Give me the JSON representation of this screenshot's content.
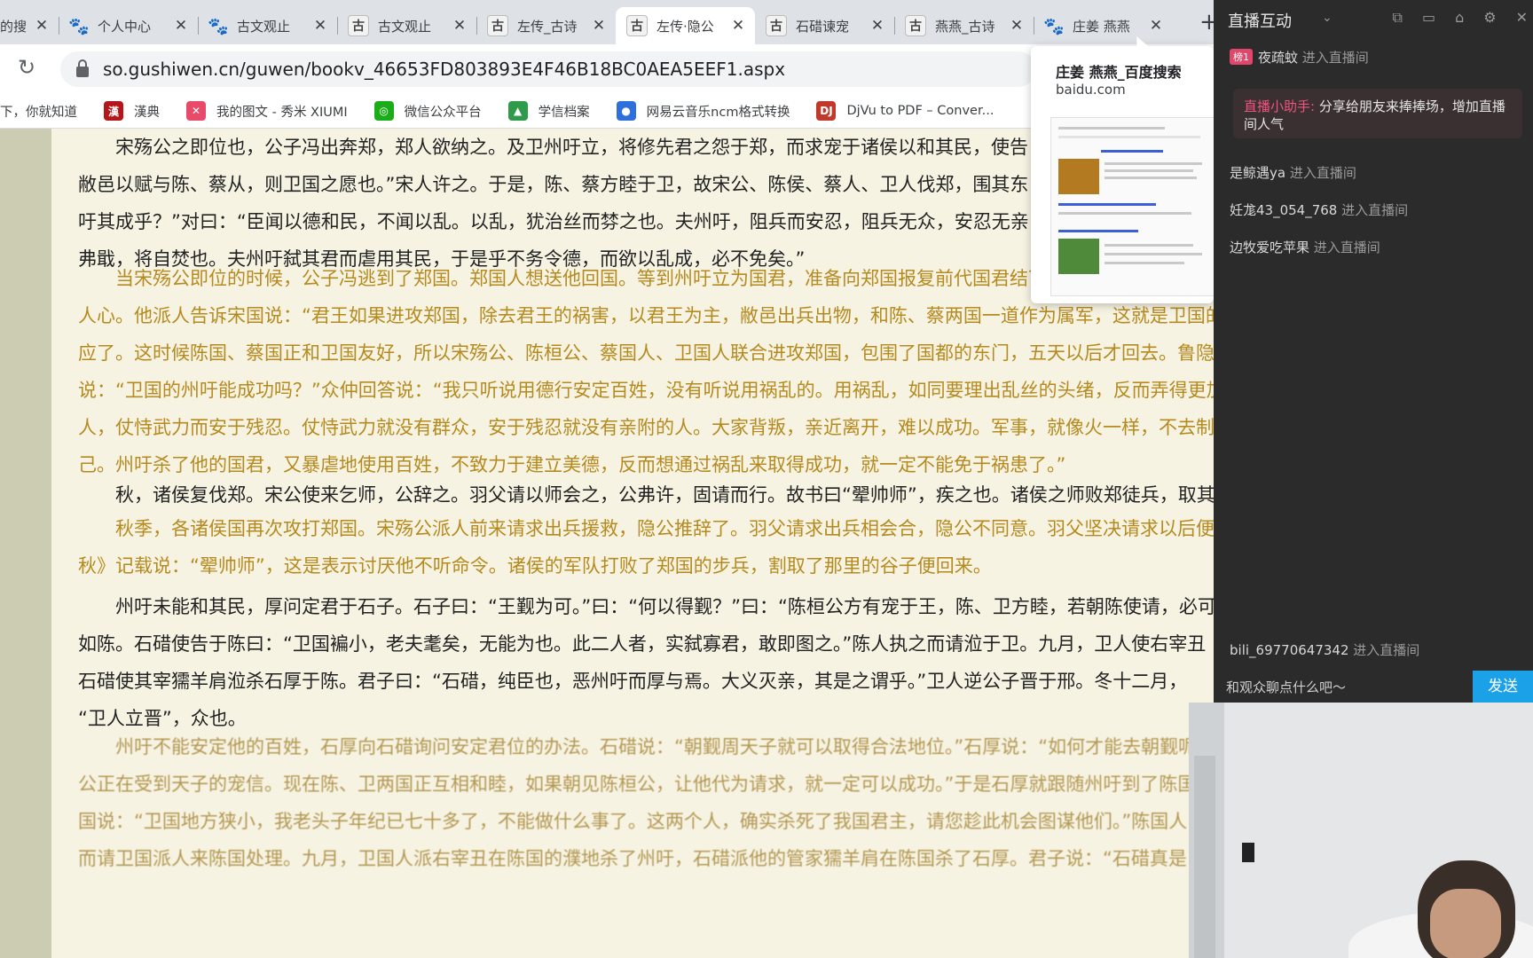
{
  "browser": {
    "tabs": [
      {
        "icon": "paw",
        "title": "的搜",
        "active": false
      },
      {
        "icon": "paw",
        "title": "个人中心",
        "active": false
      },
      {
        "icon": "paw",
        "title": "古文观止",
        "active": false
      },
      {
        "icon": "gu",
        "title": "古文观止",
        "active": false
      },
      {
        "icon": "gu",
        "title": "左传_古诗",
        "active": false
      },
      {
        "icon": "gu",
        "title": "左传·隐公",
        "active": true
      },
      {
        "icon": "gu",
        "title": "石碏谏宠",
        "active": false
      },
      {
        "icon": "gu",
        "title": "燕燕_古诗",
        "active": false
      },
      {
        "icon": "paw",
        "title": "庄姜 燕燕",
        "active": false
      }
    ],
    "new_tab": "+",
    "url": "so.gushiwen.cn/guwen/bookv_46653FD803893E4F46B18BC0AEA5EEF1.aspx",
    "bookmarks": [
      {
        "label": "下，你就知道",
        "icon": "",
        "color": ""
      },
      {
        "label": "漢典",
        "icon": "漢",
        "color": "#b5161b"
      },
      {
        "label": "我的图文 - 秀米 XIUMI",
        "icon": "✕",
        "color": "#e84b6a"
      },
      {
        "label": "微信公众平台",
        "icon": "◎",
        "color": "#1aad19"
      },
      {
        "label": "学信档案",
        "icon": "▲",
        "color": "#2e9b4a"
      },
      {
        "label": "网易云音乐ncm格式转换",
        "icon": "●",
        "color": "#2f6fdb"
      },
      {
        "label": "DjVu to PDF – Conver...",
        "icon": "DJ",
        "color": "#c0392b"
      }
    ]
  },
  "popup": {
    "title": "庄姜 燕燕_百度搜索",
    "domain": "baidu.com"
  },
  "article": {
    "paragraphs": [
      {
        "type": "orig",
        "lines": [
          "宋殇公之即位也，公子冯出奔郑，郑人欲纳之。及卫州吁立，将修先君之怨于郑，而求宠于诸侯以和其民，使告",
          "敝邑以赋与陈、蔡从，则卫国之愿也。”宋人许之。于是，陈、蔡方睦于卫，故宋公、陈侯、蔡人、卫人伐郑，围其东",
          "吁其成乎？”对曰：“臣闻以德和民，不闻以乱。以乱，犹治丝而棼之也。夫州吁，阻兵而安忍，阻兵无众，安忍无亲，",
          "弗戢，将自焚也。夫州吁弑其君而虐用其民，于是乎不务令德，而欲以乱成，必不免矣。”"
        ]
      },
      {
        "type": "trans",
        "lines": [
          "当宋殇公即位的时候，公子冯逃到了郑国。郑国人想送他回国。等到州吁立为国君，准备向郑国报复前代国君结下的怨恨，以此讨好诸侯",
          "人心。他派人告诉宋国说：“君王如果进攻郑国，除去君王的祸害，以君王为主，敝邑出兵出物，和陈、蔡两国一道作为属军，这就是卫国的",
          "应了。这时候陈国、蔡国正和卫国友好，所以宋殇公、陈桓公、蔡国人、卫国人联合进攻郑国，包围了国都的东门，五天以后才回去。鲁隐",
          "说：“卫国的州吁能成功吗？”众仲回答说：“我只听说用德行安定百姓，没有听说用祸乱的。用祸乱，如同要理出乱丝的头绪，反而弄得更加",
          "人，仗恃武力而安于残忍。仗恃武力就没有群众，安于残忍就没有亲附的人。大家背叛，亲近离开，难以成功。军事，就像火一样，不去制",
          "己。州吁杀了他的国君，又暴虐地使用百姓，不致力于建立美德，反而想通过祸乱来取得成功，就一定不能免于祸患了。”"
        ]
      },
      {
        "type": "orig",
        "lines": [
          "秋，诸侯复伐郑。宋公使来乞师，公辞之。羽父请以师会之，公弗许，固请而行。故书曰“翚帅师”，疾之也。诸侯之师败郑徒兵，取其禾"
        ]
      },
      {
        "type": "trans",
        "lines": [
          "秋季，各诸侯国再次攻打郑国。宋殇公派人前来请求出兵援救，隐公推辞了。羽父请求出兵相会合，隐公不同意。羽父坚决请求以后便",
          "秋》记载说：“翚帅师”，这是表示讨厌他不听命令。诸侯的军队打败了郑国的步兵，割取了那里的谷子便回来。"
        ]
      },
      {
        "type": "orig",
        "lines": [
          "州吁未能和其民，厚问定君于石子。石子曰：“王觐为可。”曰：“何以得觐？”曰：“陈桓公方有宠于王，陈、卫方睦，若朝陈使请，必可",
          "如陈。石碏使告于陈曰：“卫国褊小，老夫耄矣，无能为也。此二人者，实弑寡君，敢即图之。”陈人执之而请涖于卫。九月，卫人使右宰丑",
          "石碏使其宰獳羊肩涖杀石厚于陈。君子曰：“石碏，纯臣也，恶州吁而厚与焉。大义灭亲，其是之谓乎。”卫人逆公子晋于邢。冬十二月，",
          "“卫人立晋”，众也。"
        ]
      },
      {
        "type": "fade",
        "lines": [
          "州吁不能安定他的百姓，石厚向石碏询问安定君位的办法。石碏说：“朝觐周天子就可以取得合法地位。”石厚说：“如何才能去朝觐呢",
          "公正在受到天子的宠信。现在陈、卫两国正互相和睦，如果朝见陈桓公，让他代为请求，就一定可以成功。”于是石厚就跟随州吁到了陈国",
          "国说：“卫国地方狭小，我老头子年纪已七十多了，不能做什么事了。这两个人，确实杀死了我国君主，请您趁此机会图谋他们。”陈国人",
          "而请卫国派人来陈国处理。九月，卫国人派右宰丑在陈国的濮地杀了州吁，石碏派他的管家獳羊肩在陈国杀了石厚。君子说：“石碏真是"
        ]
      }
    ]
  },
  "live": {
    "header": "直播互动",
    "assistant_label": "直播小助手:",
    "assistant_text": " 分享给朋友来捧捧场，增加直播间人气",
    "messages": [
      {
        "badge": "榜1",
        "user": "夜疏蚊",
        "action": " 进入直播间"
      },
      {
        "badge": "",
        "user": "是鲸遇ya",
        "action": " 进入直播间"
      },
      {
        "badge": "",
        "user": "妊尨43_054_768",
        "action": " 进入直播间"
      },
      {
        "badge": "",
        "user": "边牧爱吃苹果",
        "action": " 进入直播间"
      },
      {
        "badge": "",
        "user": "bili_69770647342",
        "action": " 进入直播间"
      }
    ],
    "input_placeholder": "和观众聊点什么吧～",
    "send_label": "发送"
  }
}
